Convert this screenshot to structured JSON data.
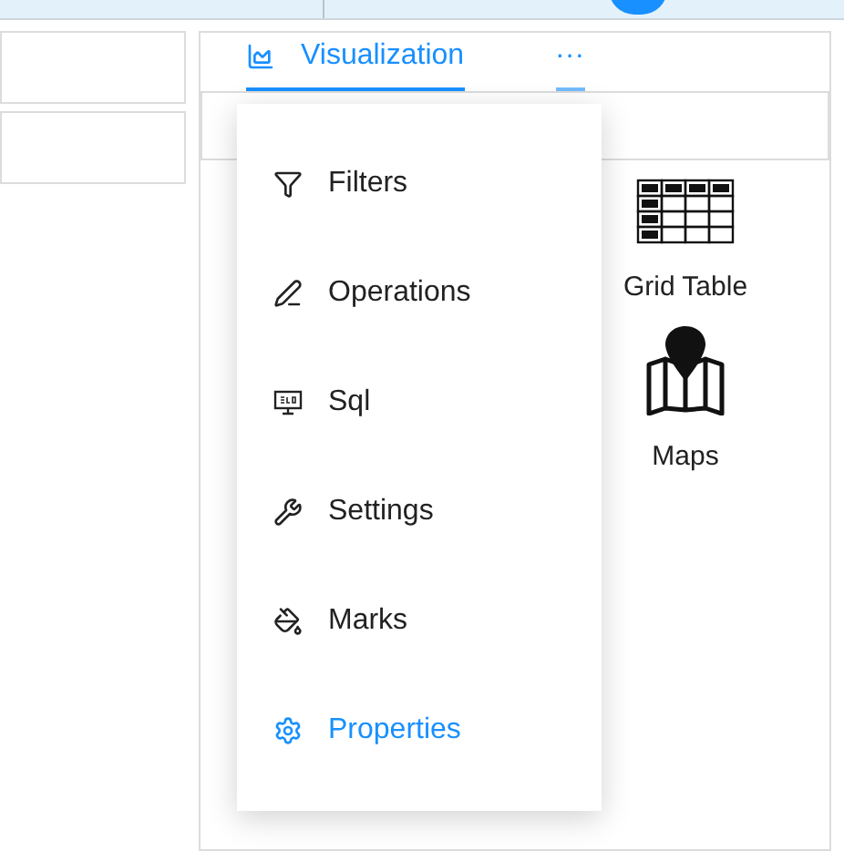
{
  "tabs": [
    {
      "label": "Visualization",
      "selected": true,
      "kind": "chart"
    },
    {
      "label": "···",
      "selected": false,
      "kind": "more"
    }
  ],
  "menu": [
    {
      "label": "Filters",
      "kind": "filter",
      "selected": false
    },
    {
      "label": "Operations",
      "kind": "edit",
      "selected": false
    },
    {
      "label": "Sql",
      "kind": "sql",
      "selected": false
    },
    {
      "label": "Settings",
      "kind": "wrench",
      "selected": false
    },
    {
      "label": "Marks",
      "kind": "paint",
      "selected": false
    },
    {
      "label": "Properties",
      "kind": "gear",
      "selected": true
    }
  ],
  "visuals": [
    {
      "label": "Grid Table",
      "kind": "grid"
    },
    {
      "label": "Maps",
      "kind": "map"
    }
  ]
}
